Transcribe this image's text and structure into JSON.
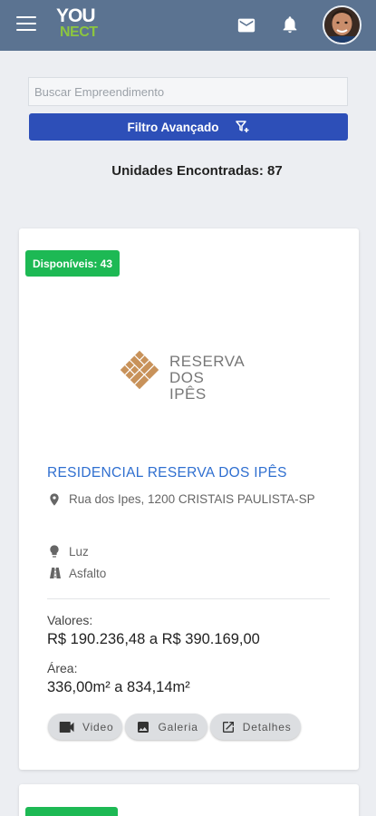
{
  "header": {
    "logo_top": "YOU",
    "logo_bottom": "NECT",
    "icons": [
      "menu-icon",
      "mail-icon",
      "bell-icon"
    ]
  },
  "search": {
    "placeholder": "Buscar Empreendimento",
    "value": ""
  },
  "filter": {
    "label": "Filtro Avançado",
    "icon": "filter-plus-icon"
  },
  "results": {
    "count_text": "Unidades Encontradas: 87"
  },
  "colors": {
    "header": "#5b7391",
    "primary_button": "#2d4fb8",
    "badge": "#1db954",
    "title_link": "#2f6fd0",
    "logo_accent": "#8cc63f",
    "brand_tile": "#c8925a"
  },
  "listing": {
    "badge": "Disponíveis: 43",
    "brand_line1": "RESERVA",
    "brand_line2": "DOS IPÊS",
    "title": "RESIDENCIAL RESERVA DOS IPÊS",
    "address": "Rua dos Ipes, 1200 CRISTAIS PAULISTA-SP",
    "features": [
      {
        "icon": "lightbulb-icon",
        "label": "Luz"
      },
      {
        "icon": "road-icon",
        "label": "Asfalto"
      }
    ],
    "values_label": "Valores:",
    "values": "R$ 190.236,48 a R$ 390.169,00",
    "area_label": "Área:",
    "area": "336,00m² a 834,14m²",
    "actions": [
      {
        "icon": "video-icon",
        "label": "Video"
      },
      {
        "icon": "image-icon",
        "label": "Galeria"
      },
      {
        "icon": "open-external-icon",
        "label": "Detalhes"
      }
    ]
  }
}
